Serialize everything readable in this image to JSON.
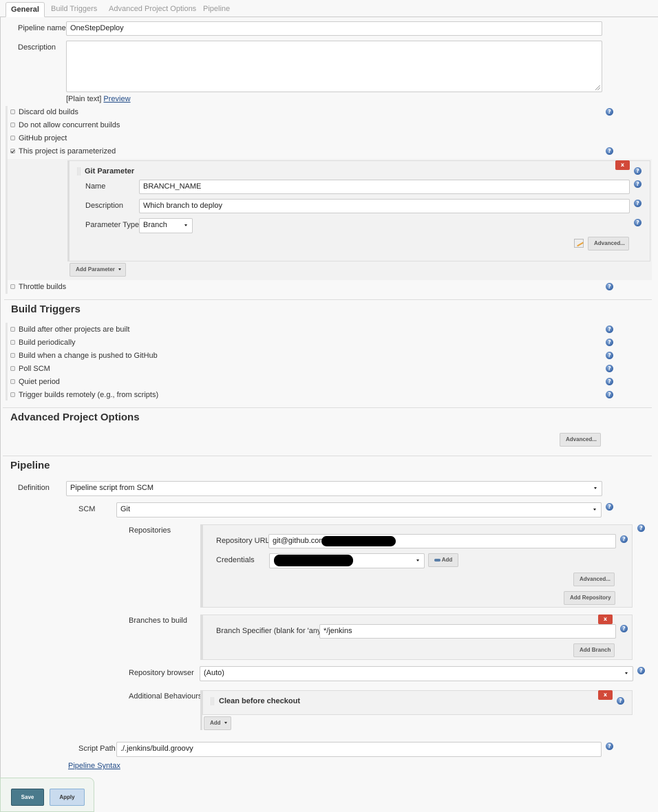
{
  "tabs": [
    {
      "label": "General",
      "active": true
    },
    {
      "label": "Build Triggers",
      "active": false
    },
    {
      "label": "Advanced Project Options",
      "active": false
    },
    {
      "label": "Pipeline",
      "active": false
    }
  ],
  "general": {
    "pipeline_name_label": "Pipeline name",
    "pipeline_name_value": "OneStepDeploy",
    "description_label": "Description",
    "description_value": "",
    "plain_text": "[Plain text]",
    "preview_link": "Preview",
    "options": [
      {
        "label": "Discard old builds",
        "checked": false
      },
      {
        "label": "Do not allow concurrent builds",
        "checked": false
      },
      {
        "label": "GitHub project",
        "checked": false
      },
      {
        "label": "This project is parameterized",
        "checked": true
      }
    ],
    "git_parameter": {
      "title": "Git Parameter",
      "delete_label": "x",
      "name_label": "Name",
      "name_value": "BRANCH_NAME",
      "description_label": "Description",
      "description_value": "Which branch to deploy",
      "type_label": "Parameter Type",
      "type_value": "Branch",
      "advanced_label": "Advanced..."
    },
    "add_parameter_label": "Add Parameter",
    "throttle_label": "Throttle builds"
  },
  "build_triggers": {
    "title": "Build Triggers",
    "options": [
      {
        "label": "Build after other projects are built",
        "checked": false
      },
      {
        "label": "Build periodically",
        "checked": false
      },
      {
        "label": "Build when a change is pushed to GitHub",
        "checked": false
      },
      {
        "label": "Poll SCM",
        "checked": false
      },
      {
        "label": "Quiet period",
        "checked": false
      },
      {
        "label": "Trigger builds remotely (e.g., from scripts)",
        "checked": false
      }
    ]
  },
  "advanced_project_options": {
    "title": "Advanced Project Options",
    "advanced_label": "Advanced..."
  },
  "pipeline": {
    "title": "Pipeline",
    "definition_label": "Definition",
    "definition_value": "Pipeline script from SCM",
    "scm_label": "SCM",
    "scm_value": "Git",
    "repositories_label": "Repositories",
    "repo_url_label": "Repository URL",
    "repo_url_value": "git@github.com:",
    "credentials_label": "Credentials",
    "credentials_value": "",
    "add_credentials_label": "Add",
    "repo_advanced_label": "Advanced...",
    "add_repository_label": "Add Repository",
    "branches_label": "Branches to build",
    "branch_delete_label": "x",
    "branch_specifier_label": "Branch Specifier (blank for 'any')",
    "branch_specifier_value": "*/jenkins",
    "add_branch_label": "Add Branch",
    "repo_browser_label": "Repository browser",
    "repo_browser_value": "(Auto)",
    "additional_behaviours_label": "Additional Behaviours",
    "behaviour_title": "Clean before checkout",
    "behaviour_delete_label": "x",
    "add_behaviour_label": "Add",
    "script_path_label": "Script Path",
    "script_path_value": "./.jenkins/build.groovy",
    "pipeline_syntax_link": "Pipeline Syntax"
  },
  "footer": {
    "save_label": "Save",
    "apply_label": "Apply"
  },
  "help_icon_glyph": "?"
}
